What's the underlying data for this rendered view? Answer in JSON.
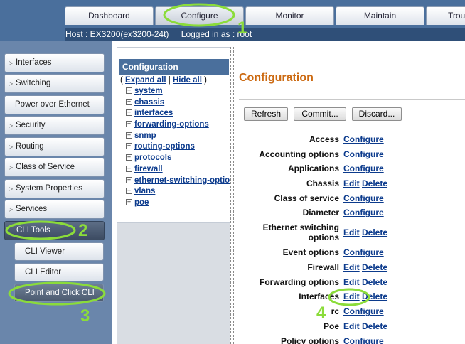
{
  "tabs": [
    {
      "label": "Dashboard"
    },
    {
      "label": "Configure",
      "active": true
    },
    {
      "label": "Monitor"
    },
    {
      "label": "Maintain"
    },
    {
      "label": "Trou"
    }
  ],
  "host": {
    "host_text": "Host : EX3200(ex3200-24t)",
    "login_text": "Logged in as : root"
  },
  "leftnav": {
    "items": [
      {
        "label": "Interfaces",
        "arrow": "▷"
      },
      {
        "label": "Switching",
        "arrow": "▷"
      },
      {
        "label": "Power over Ethernet"
      },
      {
        "label": "Security",
        "arrow": "▷"
      },
      {
        "label": "Routing",
        "arrow": "▷"
      },
      {
        "label": "Class of Service",
        "arrow": "▷"
      },
      {
        "label": "System Properties",
        "arrow": "▷"
      },
      {
        "label": "Services",
        "arrow": "▷"
      },
      {
        "label": "CLI Tools"
      }
    ],
    "subitems": [
      {
        "label": "CLI Viewer"
      },
      {
        "label": "CLI Editor"
      },
      {
        "label": "Point and Click CLI",
        "selected": true
      }
    ]
  },
  "tree": {
    "title": "Configuration",
    "open_paren": "(",
    "expand_all": "Expand all",
    "separator": "|",
    "hide_all": "Hide all",
    "close_paren": ")",
    "plus": "+",
    "items": [
      "system",
      "chassis",
      "interfaces",
      "forwarding-options",
      "snmp",
      "routing-options",
      "protocols",
      "firewall",
      "ethernet-switching-options",
      "vlans",
      "poe"
    ]
  },
  "config": {
    "title": "Configuration",
    "buttons": {
      "refresh": "Refresh",
      "commit": "Commit...",
      "discard": "Discard..."
    },
    "rows": [
      {
        "label": "Access",
        "actions": [
          "Configure"
        ]
      },
      {
        "label": "Accounting options",
        "actions": [
          "Configure"
        ]
      },
      {
        "label": "Applications",
        "actions": [
          "Configure"
        ]
      },
      {
        "label": "Chassis",
        "actions": [
          "Edit",
          "Delete"
        ]
      },
      {
        "label": "Class of service",
        "actions": [
          "Configure"
        ]
      },
      {
        "label": "Diameter",
        "actions": [
          "Configure"
        ]
      },
      {
        "label": "Ethernet switching options",
        "actions": [
          "Edit",
          "Delete"
        ]
      },
      {
        "label": "Event options",
        "actions": [
          "Configure"
        ]
      },
      {
        "label": "Firewall",
        "actions": [
          "Edit",
          "Delete"
        ]
      },
      {
        "label": "Forwarding options",
        "actions": [
          "Edit",
          "Delete"
        ]
      },
      {
        "label": "Interfaces",
        "actions": [
          "Edit",
          "Delete"
        ]
      },
      {
        "label": "rc",
        "actions": [
          "Configure"
        ]
      },
      {
        "label": "Poe",
        "actions": [
          "Edit",
          "Delete"
        ]
      },
      {
        "label": "Policy options",
        "actions": [
          "Configure"
        ]
      }
    ]
  },
  "annotations": [
    "1",
    "2",
    "3",
    "4"
  ],
  "colors": {
    "header_blue": "#4a6f9c",
    "nav_blue": "#6a86ab",
    "title_orange": "#cc6a12",
    "link_blue": "#0b3a8c",
    "annotation_green": "#8bdc3a"
  }
}
